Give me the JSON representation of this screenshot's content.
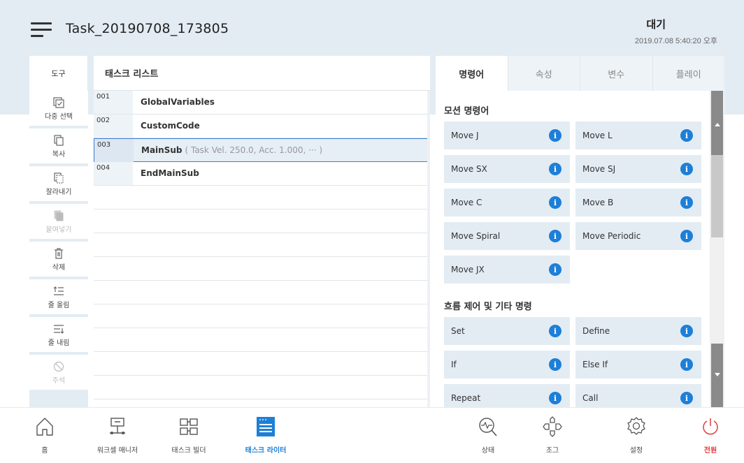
{
  "header": {
    "title": "Task_20190708_173805",
    "state": "대기",
    "datetime": "2019.07.08 5:40:20 오후"
  },
  "tools": {
    "heading": "도구",
    "items": [
      {
        "label": "다중 선택",
        "icon": "multi-select-icon",
        "enabled": true
      },
      {
        "label": "복사",
        "icon": "copy-icon",
        "enabled": true
      },
      {
        "label": "잘라내기",
        "icon": "cut-icon",
        "enabled": true
      },
      {
        "label": "붙여넣기",
        "icon": "paste-icon",
        "enabled": false
      },
      {
        "label": "삭제",
        "icon": "trash-icon",
        "enabled": true
      },
      {
        "label": "줄 올림",
        "icon": "indent-up-icon",
        "enabled": true
      },
      {
        "label": "줄 내림",
        "icon": "indent-down-icon",
        "enabled": true
      },
      {
        "label": "주석",
        "icon": "comment-off-icon",
        "enabled": false
      }
    ]
  },
  "task_list": {
    "heading": "태스크 리스트",
    "rows": [
      {
        "num": "001",
        "name": "GlobalVariables",
        "param": ""
      },
      {
        "num": "002",
        "name": "CustomCode",
        "param": ""
      },
      {
        "num": "003",
        "name": "MainSub",
        "param": "( Task Vel. 250.0, Acc. 1.000, ··· )",
        "selected": true
      },
      {
        "num": "004",
        "name": "EndMainSub",
        "param": ""
      }
    ]
  },
  "commands": {
    "tabs": [
      "명령어",
      "속성",
      "변수",
      "플레이"
    ],
    "active_tab": "명령어",
    "motion_title": "모션 명령어",
    "motion": [
      "Move J",
      "Move L",
      "Move SX",
      "Move SJ",
      "Move C",
      "Move B",
      "Move Spiral",
      "Move Periodic",
      "Move JX"
    ],
    "flow_title": "흐름 제어 및 기타 명령",
    "flow": [
      "Set",
      "Define",
      "If",
      "Else If",
      "Repeat",
      "Call"
    ],
    "info_glyph": "i"
  },
  "bottom_nav": [
    {
      "label": "홈",
      "icon": "home-icon"
    },
    {
      "label": "워크셀 매니저",
      "icon": "workcell-manager-icon"
    },
    {
      "label": "태스크 빌더",
      "icon": "task-builder-icon"
    },
    {
      "label": "태스크 라이터",
      "icon": "task-writer-icon",
      "active": true
    },
    {
      "label": "상태",
      "icon": "status-icon"
    },
    {
      "label": "조그",
      "icon": "jog-icon"
    },
    {
      "label": "설정",
      "icon": "settings-icon"
    },
    {
      "label": "전원",
      "icon": "power-icon"
    }
  ],
  "colors": {
    "accent": "#1d7fd8",
    "power": "#e23b3b",
    "panel_bg": "#e3ecf3"
  }
}
